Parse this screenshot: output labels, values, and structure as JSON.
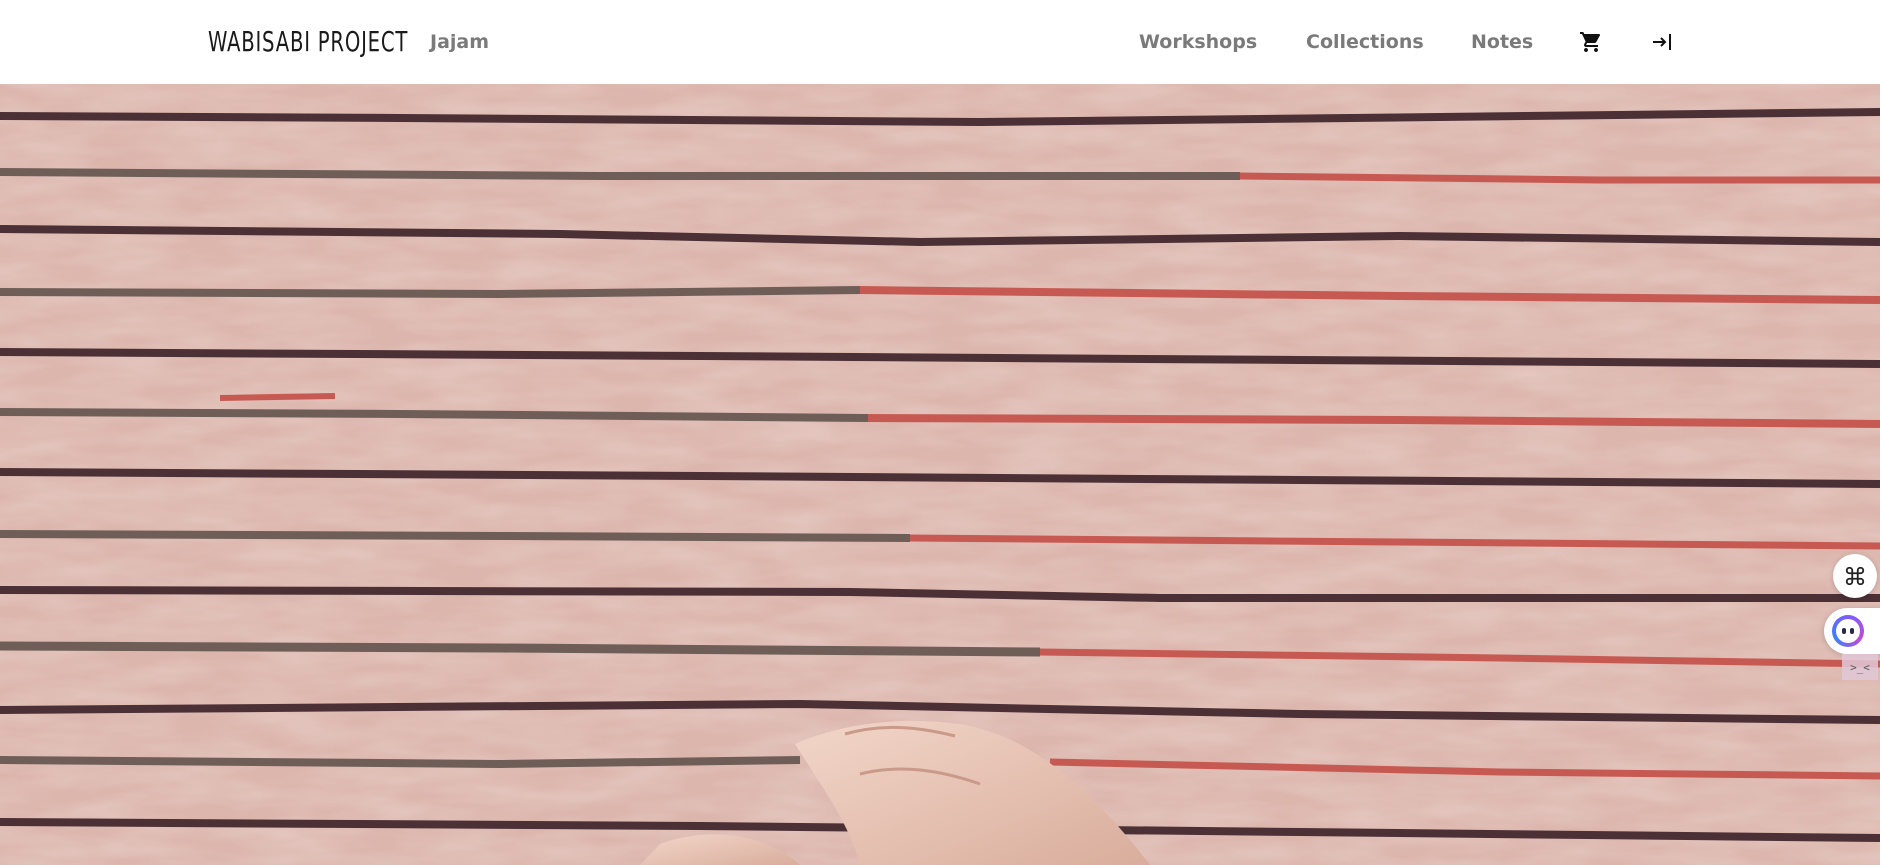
{
  "header": {
    "logo_text": "WABISABI PROJECT",
    "nav_left": [
      {
        "label": "Jajam"
      }
    ],
    "nav_right": [
      {
        "label": "Workshops"
      },
      {
        "label": "Collections"
      },
      {
        "label": "Notes"
      }
    ],
    "icons": {
      "cart": "shopping-cart-icon",
      "login": "login-icon"
    }
  },
  "hero": {
    "image": "block-printed textile with horizontal stripes, hand printing",
    "colors": {
      "fabric": "#dcb6ad",
      "dark_stripe": "#4b3036",
      "grey_stripe": "#6e5e57",
      "red_stripe": "#c65a52"
    }
  },
  "side_widgets": {
    "grid": "command-grid-icon",
    "assistant": "assistant-face-icon",
    "code": "code-icon",
    "code_text": ">_<"
  }
}
